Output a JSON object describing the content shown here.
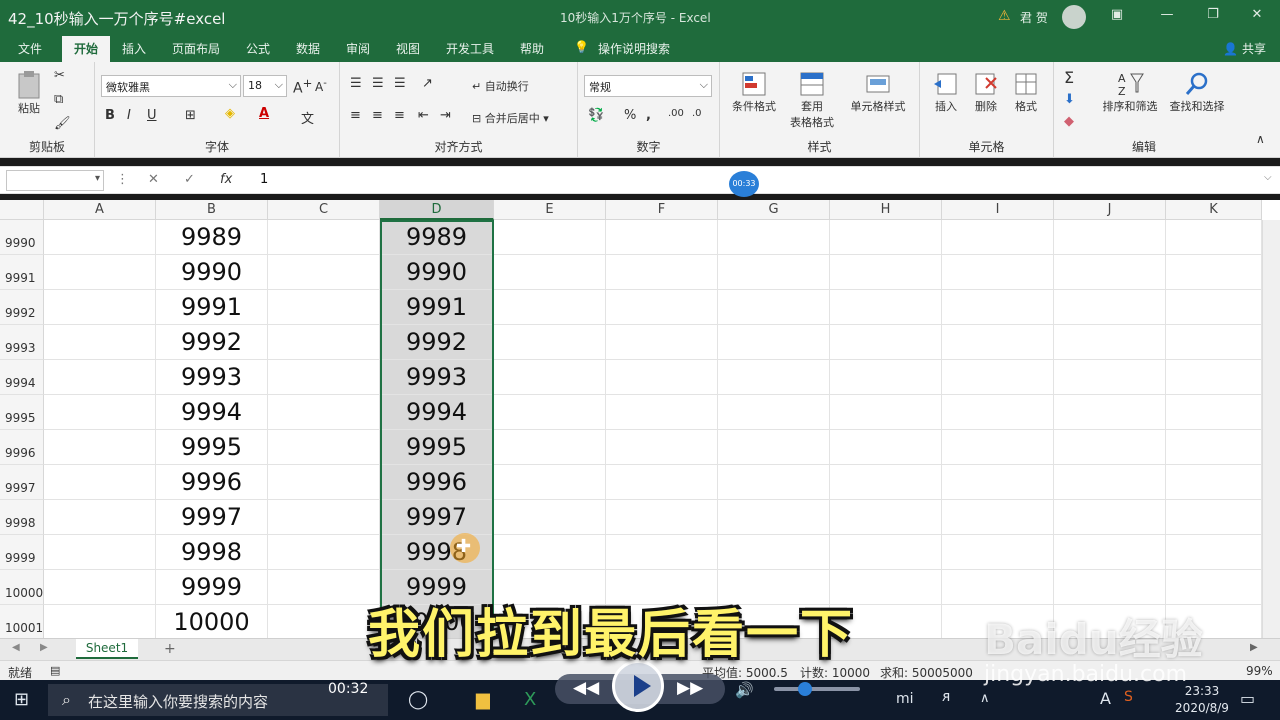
{
  "video": {
    "title": "42_10秒输入一万个序号#excel",
    "time_left": "00:32",
    "time_badge": "00:33"
  },
  "window": {
    "doc_title": "10秒输入1万个序号 - Excel",
    "user": "君 贺"
  },
  "ribbon_tabs": [
    "文件",
    "开始",
    "插入",
    "页面布局",
    "公式",
    "数据",
    "审阅",
    "视图",
    "开发工具",
    "帮助",
    "操作说明搜索"
  ],
  "active_tab": "开始",
  "share_label": "共享",
  "clipboard": {
    "paste": "粘贴",
    "group": "剪贴板"
  },
  "font": {
    "name": "微软雅黑",
    "size": "18",
    "group": "字体",
    "bold": "B",
    "italic": "I",
    "underline": "U"
  },
  "alignment": {
    "wrap": "自动换行",
    "merge": "合并后居中",
    "group": "对齐方式"
  },
  "number": {
    "format": "常规",
    "group": "数字",
    "percent": "%",
    "comma": ","
  },
  "styles": {
    "cond": "条件格式",
    "table": "套用",
    "table2": "表格格式",
    "cell": "单元格样式",
    "group": "样式"
  },
  "cells": {
    "insert": "插入",
    "delete": "删除",
    "format": "格式",
    "group": "单元格"
  },
  "editing": {
    "sort": "排序和筛选",
    "find": "查找和选择",
    "group": "编辑"
  },
  "formula_bar": {
    "fx": "fx",
    "value": "1"
  },
  "columns": [
    "A",
    "B",
    "C",
    "D",
    "E",
    "F",
    "G",
    "H",
    "I",
    "J",
    "K"
  ],
  "rows": [
    {
      "hdr": "9990",
      "b": "9989",
      "d": "9989"
    },
    {
      "hdr": "9991",
      "b": "9990",
      "d": "9990"
    },
    {
      "hdr": "9992",
      "b": "9991",
      "d": "9991"
    },
    {
      "hdr": "9993",
      "b": "9992",
      "d": "9992"
    },
    {
      "hdr": "9994",
      "b": "9993",
      "d": "9993"
    },
    {
      "hdr": "9995",
      "b": "9994",
      "d": "9994"
    },
    {
      "hdr": "9996",
      "b": "9995",
      "d": "9995"
    },
    {
      "hdr": "9997",
      "b": "9996",
      "d": "9996"
    },
    {
      "hdr": "9998",
      "b": "9997",
      "d": "9997"
    },
    {
      "hdr": "9999",
      "b": "9998",
      "d": "9998"
    },
    {
      "hdr": "10000",
      "b": "9999",
      "d": "9999"
    },
    {
      "hdr": "10001",
      "b": "10000",
      "d": "10000"
    }
  ],
  "sheet": {
    "tab": "Sheet1",
    "add": "+"
  },
  "status": {
    "ready": "就绪",
    "average": "平均值: 5000.5",
    "count": "计数: 10000",
    "sum": "求和: 50005000",
    "zoom": "99%"
  },
  "taskbar": {
    "search": "在这里输入你要搜索的内容",
    "time": "23:33",
    "date": "2020/8/9"
  },
  "subtitle": "我们拉到最后看一下",
  "watermark": {
    "logo": "Baidu经验",
    "url": "jingyan.baidu.com"
  }
}
